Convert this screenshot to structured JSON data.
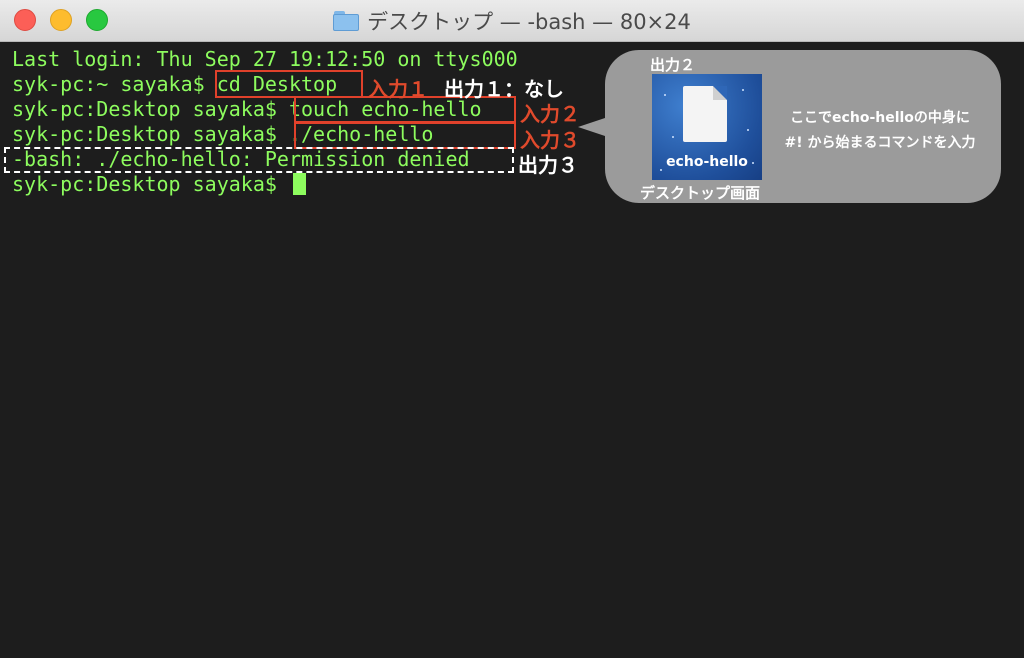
{
  "window": {
    "title": "デスクトップ — -bash — 80×24"
  },
  "terminal": {
    "lines": [
      "Last login: Thu Sep 27 19:12:50 on ttys000",
      "syk-pc:~ sayaka$ cd Desktop",
      "syk-pc:Desktop sayaka$ touch echo-hello",
      "syk-pc:Desktop sayaka$ ./echo-hello",
      "-bash: ./echo-hello: Permission denied",
      "syk-pc:Desktop sayaka$ "
    ]
  },
  "annotations": {
    "input1": "入力１",
    "output1": "出力１：なし",
    "input2": "入力２",
    "input3": "入力３",
    "output3": "出力３"
  },
  "callout": {
    "title": "出力２",
    "file_label": "echo-hello",
    "caption": "デスクトップ画面",
    "desc_line1": "ここでecho-helloの中身に",
    "desc_line2": "#! から始まるコマンドを入力"
  },
  "colors": {
    "terminal_text": "#8dfc5e",
    "annotation_red": "#e04a2c"
  }
}
